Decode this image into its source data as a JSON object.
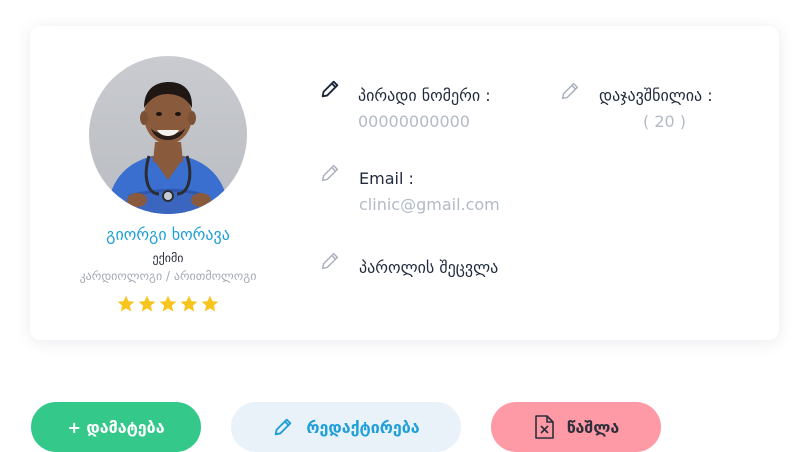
{
  "profile": {
    "name": "გიორგი ხორავა",
    "role": "ექიმი",
    "specialty": "კარდიოლოგი / არითმოლოგი",
    "rating": 5,
    "rating_max": 5
  },
  "fields": {
    "personal_number_label": "პირადი ნომერი :",
    "personal_number_value": "00000000000",
    "bookings_label": "დაჯავშნილია :",
    "bookings_value": "( 20 )",
    "email_label": "Email :",
    "email_value": "clinic@gmail.com",
    "password_label": "პაროლის შეცვლა"
  },
  "actions": {
    "add_label": "+ დამატება",
    "edit_label": "რედაქტირება",
    "delete_label": "წაშლა"
  },
  "colors": {
    "accent_blue": "#1f9fd8",
    "add_green": "#34c98b",
    "delete_pink": "#fe99a6",
    "star_yellow": "#f7c51e"
  },
  "icons": {
    "edit": "pencil-icon",
    "delete": "file-x-icon",
    "rating": "star-icon"
  }
}
